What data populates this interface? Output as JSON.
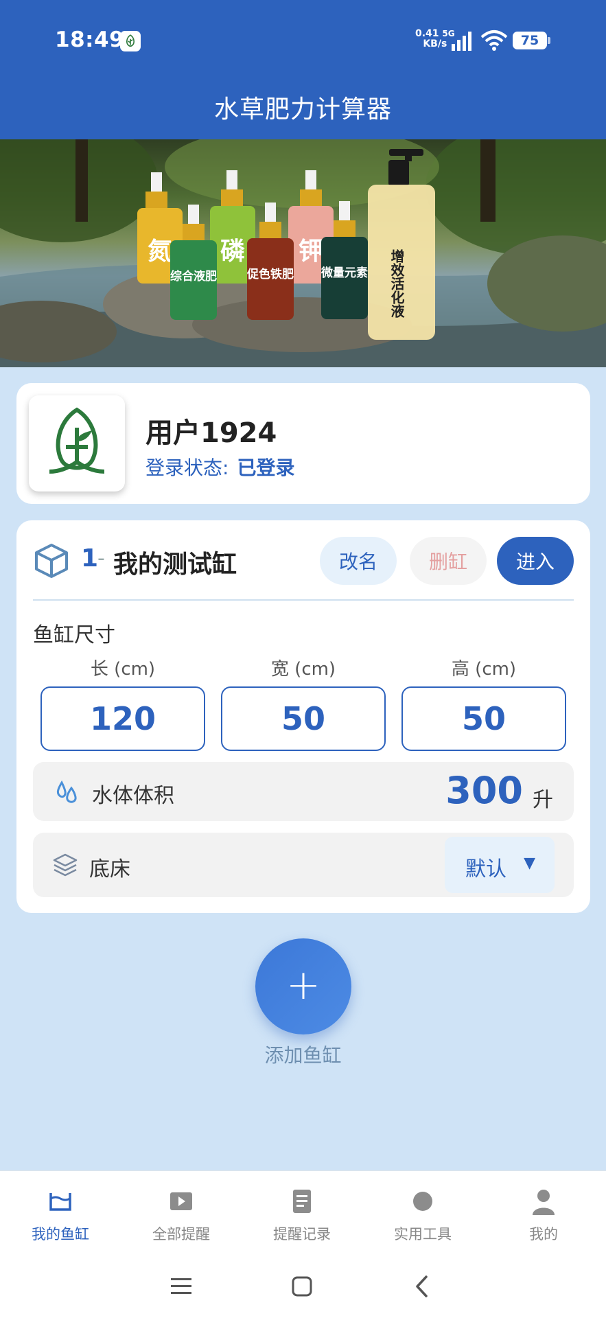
{
  "status_bar": {
    "time": "18:49",
    "net_speed_value": "0.41",
    "net_speed_unit": "KB/s",
    "network": "5G",
    "battery": "75"
  },
  "header": {
    "title": "水草肥力计算器"
  },
  "banner": {
    "bottle_labels": [
      "氮",
      "磷",
      "钾",
      "综合液肥",
      "促色铁肥",
      "微量元素",
      "增效活化液"
    ]
  },
  "user": {
    "name": "用户1924",
    "login_label": "登录状态:",
    "login_value": "已登录"
  },
  "tank": {
    "index": "1",
    "separator": "-",
    "name": "我的测试缸",
    "rename_label": "改名",
    "delete_label": "删缸",
    "enter_label": "进入",
    "size_title": "鱼缸尺寸",
    "length_label": "长 (cm)",
    "width_label": "宽 (cm)",
    "height_label": "高 (cm)",
    "length": "120",
    "width": "50",
    "height": "50",
    "volume_label": "水体体积",
    "volume_value": "300",
    "volume_unit": "升",
    "substrate_label": "底床",
    "substrate_value": "默认"
  },
  "add_tank": {
    "icon": "+",
    "label": "添加鱼缸"
  },
  "bottom_nav": {
    "items": [
      {
        "label": "我的鱼缸",
        "icon": "tank-icon",
        "active": true
      },
      {
        "label": "全部提醒",
        "icon": "play-icon",
        "active": false
      },
      {
        "label": "提醒记录",
        "icon": "document-icon",
        "active": false
      },
      {
        "label": "实用工具",
        "icon": "circle-icon",
        "active": false
      },
      {
        "label": "我的",
        "icon": "person-icon",
        "active": false
      }
    ]
  },
  "colors": {
    "primary": "#2d62bd",
    "background": "#cfe3f6",
    "card": "#ffffff",
    "delete_text": "#e4a0a0"
  }
}
